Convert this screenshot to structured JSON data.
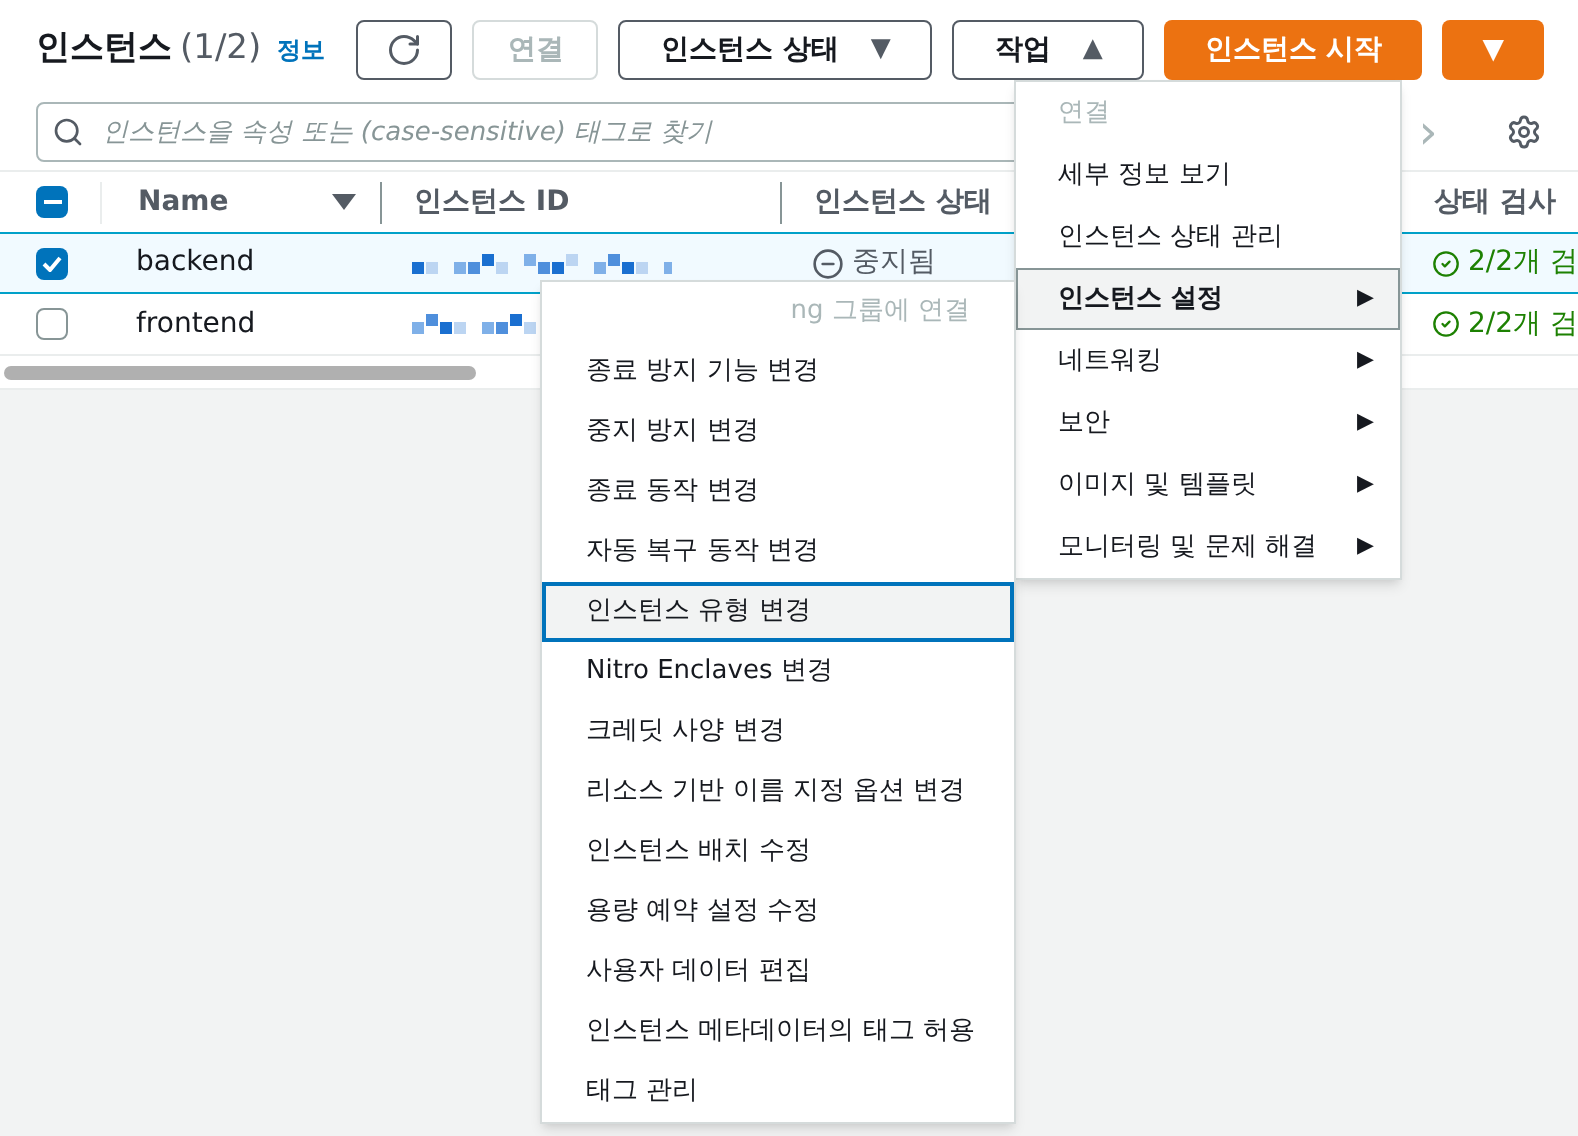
{
  "header": {
    "title": "인스턴스",
    "count": "(1/2)",
    "info_link": "정보"
  },
  "toolbar": [
    {
      "kind": "refresh",
      "disabled": false
    },
    {
      "kind": "text",
      "label": "연결",
      "disabled": true
    },
    {
      "kind": "dropdown",
      "label": "인스턴스 상태",
      "caret": "▼",
      "disabled": false
    },
    {
      "kind": "dropdown",
      "label": "작업",
      "caret": "▲",
      "disabled": false
    },
    {
      "kind": "primary",
      "label": "인스턴스 시작",
      "disabled": false
    },
    {
      "kind": "primary",
      "label": "▼",
      "disabled": false
    }
  ],
  "search": {
    "placeholder": "인스턴스을 속성 또는 (case-sensitive) 태그로 찾기"
  },
  "pagination": {
    "next": "›"
  },
  "table": {
    "indeterminate": true,
    "columns": [
      "Name",
      "인스턴스 ID",
      "인스턴스 상태",
      "상태 검사"
    ],
    "rows": [
      {
        "name": "backend",
        "checked": true,
        "selected": true,
        "status": "중지됨",
        "check": "2/2개 검"
      },
      {
        "name": "frontend",
        "checked": false,
        "selected": false,
        "check": "2/2개 검"
      }
    ]
  },
  "actions_menu": {
    "items": [
      {
        "label": "연결",
        "disabled": true,
        "kind": "item",
        "selected": false
      },
      {
        "label": "세부 정보 보기",
        "disabled": false,
        "kind": "item",
        "selected": false
      },
      {
        "label": "인스턴스 상태 관리",
        "disabled": false,
        "kind": "item",
        "selected": false
      },
      {
        "label": "인스턴스 설정",
        "disabled": false,
        "kind": "submenu",
        "selected": true
      },
      {
        "label": "네트워킹",
        "disabled": false,
        "kind": "submenu",
        "selected": false
      },
      {
        "label": "보안",
        "disabled": false,
        "kind": "submenu",
        "selected": false
      },
      {
        "label": "이미지 및 템플릿",
        "disabled": false,
        "kind": "submenu",
        "selected": false
      },
      {
        "label": "모니터링 및 문제 해결",
        "disabled": false,
        "kind": "submenu",
        "selected": false
      }
    ],
    "arrow": "▶"
  },
  "settings_submenu": {
    "items": [
      {
        "label": "ng 그룹에 연결",
        "disabled": true,
        "selected": false
      },
      {
        "label": "종료 방지 기능 변경",
        "disabled": false,
        "selected": false
      },
      {
        "label": "중지 방지 변경",
        "disabled": false,
        "selected": false
      },
      {
        "label": "종료 동작 변경",
        "disabled": false,
        "selected": false
      },
      {
        "label": "자동 복구 동작 변경",
        "disabled": false,
        "selected": false
      },
      {
        "label": "인스턴스 유형 변경",
        "disabled": false,
        "selected": true
      },
      {
        "label": "Nitro Enclaves 변경",
        "disabled": false,
        "selected": false
      },
      {
        "label": "크레딧 사양 변경",
        "disabled": false,
        "selected": false
      },
      {
        "label": "리소스 기반 이름 지정 옵션 변경",
        "disabled": false,
        "selected": false
      },
      {
        "label": "인스턴스 배치 수정",
        "disabled": false,
        "selected": false
      },
      {
        "label": "용량 예약 설정 수정",
        "disabled": false,
        "selected": false
      },
      {
        "label": "사용자 데이터 편집",
        "disabled": false,
        "selected": false
      },
      {
        "label": "인스턴스 메타데이터의 태그 허용",
        "disabled": false,
        "selected": false
      },
      {
        "label": "태그 관리",
        "disabled": false,
        "selected": false
      }
    ]
  }
}
